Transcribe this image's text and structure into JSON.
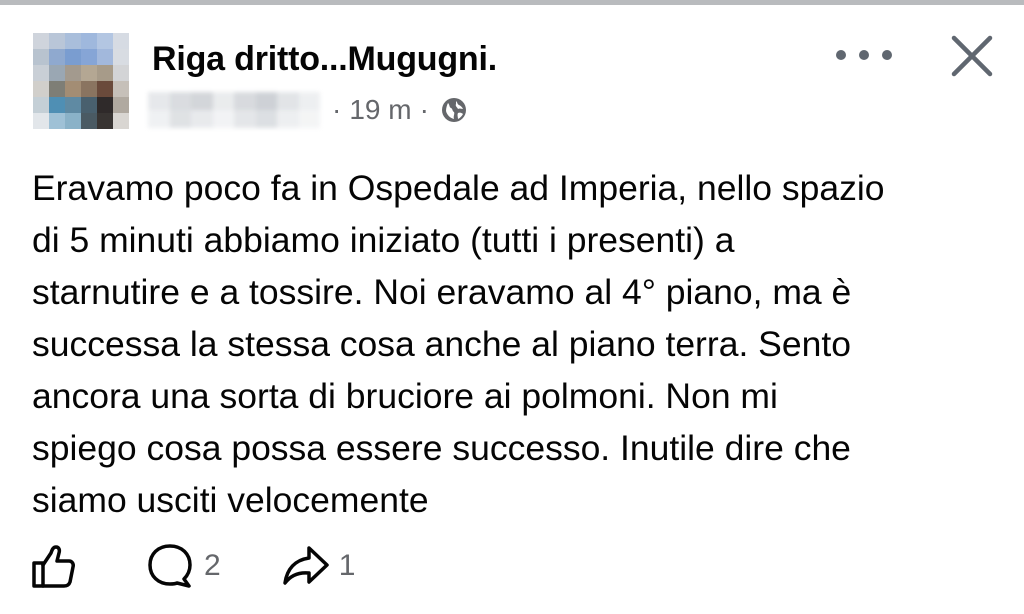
{
  "post": {
    "group_name": "Riga dritto...Mugugni.",
    "time_ago": "19 m",
    "meta_separator_1": "·",
    "meta_separator_2": "·",
    "privacy_icon": "globe-icon",
    "text": "Eravamo poco fa in Ospedale ad Imperia, nello spazio\ndi 5 minuti abbiamo iniziato (tutti i presenti) a\nstarnutire e a tossire.  Noi eravamo al 4° piano, ma è\nsuccessa la stessa cosa anche al piano terra. Sento\nancora una sorta di bruciore ai polmoni. Non mi\nspiego cosa possa essere successo. Inutile dire che\nsiamo usciti velocemente"
  },
  "header_actions": {
    "more_icon": "more-horizontal-icon",
    "close_icon": "close-icon"
  },
  "actions": {
    "like_icon": "thumbs-up-icon",
    "comment_icon": "comment-bubble-icon",
    "comment_count": "2",
    "share_icon": "share-arrow-icon",
    "share_count": "1"
  },
  "colors": {
    "text_primary": "#050505",
    "text_secondary": "#65676b",
    "background": "#ffffff",
    "top_border": "#b9bbbe"
  }
}
